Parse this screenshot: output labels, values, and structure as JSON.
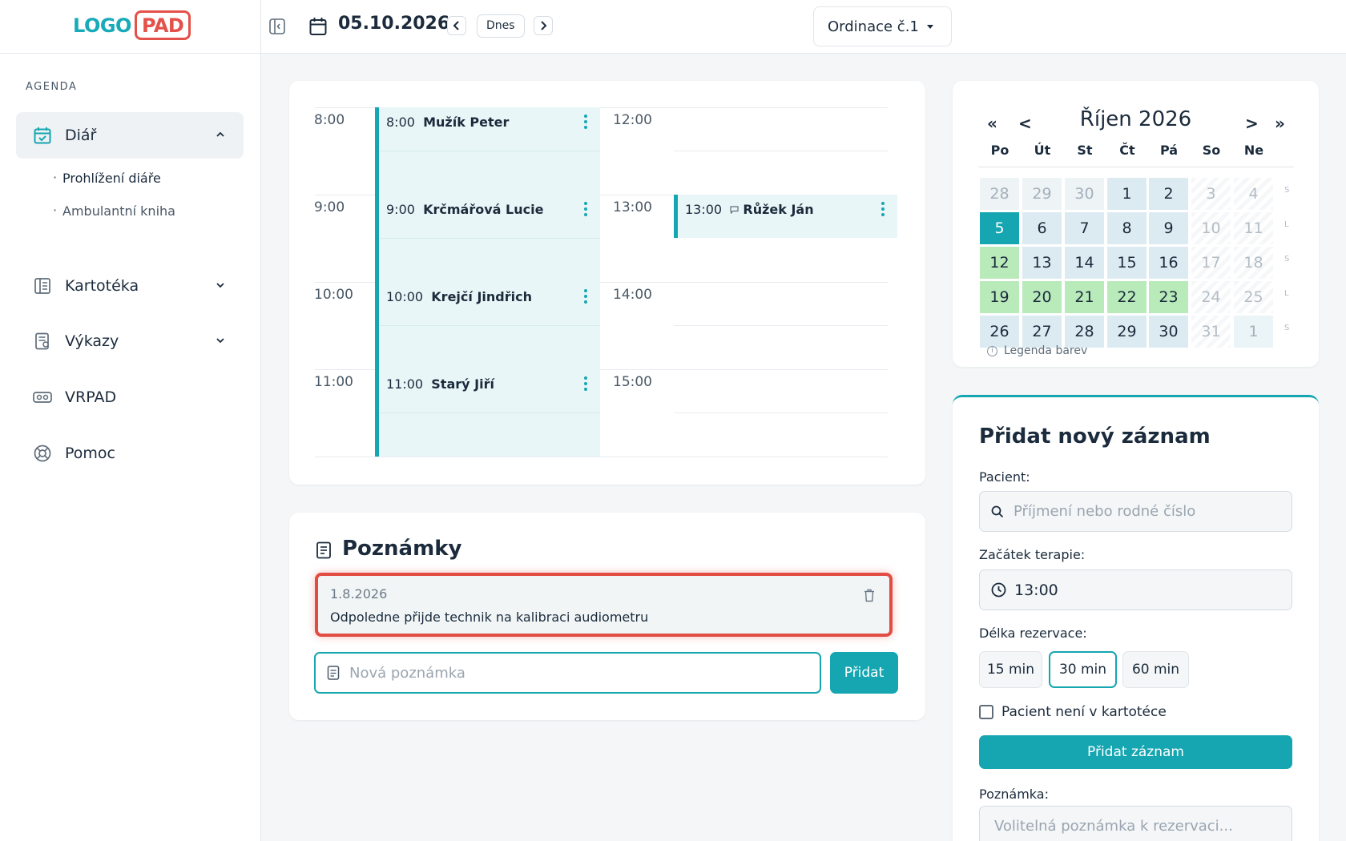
{
  "logo": {
    "part_a": "LOGO",
    "part_b": "PAD"
  },
  "topbar": {
    "date": "05.10.2026",
    "today_label": "Dnes",
    "office": "Ordinace č.1"
  },
  "sidebar": {
    "heading": "AGENDA",
    "diar": "Diář",
    "diar_sub": [
      "Prohlížení diáře",
      "Ambulantní kniha"
    ],
    "kartoteka": "Kartotéka",
    "vykazy": "Výkazy",
    "vrpad": "VRPAD",
    "pomoc": "Pomoc"
  },
  "schedule": {
    "left_times": [
      "8:00",
      "9:00",
      "10:00",
      "11:00"
    ],
    "right_times": [
      "12:00",
      "13:00",
      "14:00",
      "15:00"
    ],
    "appointments": [
      {
        "time": "8:00",
        "name": "Mužík Peter"
      },
      {
        "time": "9:00",
        "name": "Krčmářová Lucie"
      },
      {
        "time": "10:00",
        "name": "Krejčí Jindřich"
      },
      {
        "time": "11:00",
        "name": "Starý Jiří"
      },
      {
        "time": "13:00",
        "name": "Růžek Ján"
      }
    ]
  },
  "notes": {
    "title": "Poznámky",
    "items": [
      {
        "date": "1.8.2026",
        "text": "Odpoledne přijde technik na kalibraci audiometru"
      }
    ],
    "new_placeholder": "Nová poznámka",
    "add_label": "Přidat"
  },
  "calendar": {
    "title": "Říjen 2026",
    "nav": {
      "prev_year": "«",
      "prev": "<",
      "next": ">",
      "next_year": "»"
    },
    "weekdays": [
      "Po",
      "Út",
      "St",
      "Čt",
      "Pá",
      "So",
      "Ne"
    ],
    "weeks": [
      [
        "28",
        "29",
        "30",
        "1",
        "2",
        "3",
        "4"
      ],
      [
        "5",
        "6",
        "7",
        "8",
        "9",
        "10",
        "11"
      ],
      [
        "12",
        "13",
        "14",
        "15",
        "16",
        "17",
        "18"
      ],
      [
        "19",
        "20",
        "21",
        "22",
        "23",
        "24",
        "25"
      ],
      [
        "26",
        "27",
        "28",
        "29",
        "30",
        "31",
        "1"
      ]
    ],
    "week_marks": [
      "S",
      "L",
      "S",
      "L",
      "S"
    ],
    "legend": "Legenda barev",
    "colors": {
      "accent": "#15a6b1",
      "booked": "#b9eaba",
      "current": "#dcebf1"
    }
  },
  "form": {
    "title": "Přidat nový záznam",
    "patient_label": "Pacient:",
    "patient_placeholder": "Příjmení nebo rodné číslo",
    "start_label": "Začátek terapie:",
    "start_value": "13:00",
    "length_label": "Délka rezervace:",
    "lengths": [
      "15 min",
      "30 min",
      "60 min"
    ],
    "selected_length": "30 min",
    "not_in_records": "Pacient není v kartotéce",
    "submit": "Přidat záznam",
    "note_label": "Poznámka:",
    "note_placeholder": "Volitelná poznámka k rezervaci..."
  }
}
